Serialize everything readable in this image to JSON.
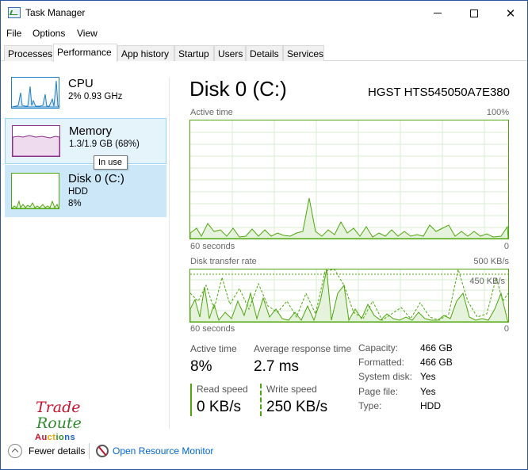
{
  "window": {
    "title": "Task Manager"
  },
  "menu": {
    "file": "File",
    "options": "Options",
    "view": "View"
  },
  "tabs": [
    {
      "label": "Processes"
    },
    {
      "label": "Performance",
      "active": true
    },
    {
      "label": "App history"
    },
    {
      "label": "Startup"
    },
    {
      "label": "Users"
    },
    {
      "label": "Details"
    },
    {
      "label": "Services"
    }
  ],
  "sidebar": {
    "cpu": {
      "name": "CPU",
      "detail": "2%  0.93 GHz",
      "color": "#1c7ec4"
    },
    "memory": {
      "name": "Memory",
      "detail": "1.3/1.9 GB (68%)",
      "color": "#8b2d8b"
    },
    "disk": {
      "name": "Disk 0 (C:)",
      "type": "HDD",
      "usage": "8%",
      "color": "#4da60c"
    },
    "tooltip": "In use"
  },
  "detail": {
    "title": "Disk 0 (C:)",
    "model": "HGST HTS545050A7E380",
    "active_graph": {
      "label": "Active time",
      "max_label": "100%",
      "time_label": "60 seconds",
      "min_label": "0"
    },
    "transfer_graph": {
      "label": "Disk transfer rate",
      "max_label": "500 KB/s",
      "ref_label": "450 KB/s",
      "time_label": "60 seconds",
      "min_label": "0"
    },
    "stats": {
      "active_time_label": "Active time",
      "active_time_value": "8%",
      "avg_response_label": "Average response time",
      "avg_response_value": "2.7 ms",
      "read_speed_label": "Read speed",
      "read_speed_value": "0 KB/s",
      "write_speed_label": "Write speed",
      "write_speed_value": "250 KB/s"
    },
    "properties": [
      {
        "key": "Capacity:",
        "value": "466 GB"
      },
      {
        "key": "Formatted:",
        "value": "466 GB"
      },
      {
        "key": "System disk:",
        "value": "Yes"
      },
      {
        "key": "Page file:",
        "value": "Yes"
      },
      {
        "key": "Type:",
        "value": "HDD"
      }
    ]
  },
  "logo": {
    "line1": "Trade",
    "line2": "Route",
    "line3": "Auctions"
  },
  "footer": {
    "fewer_details": "Fewer details",
    "resource_monitor": "Open Resource Monitor"
  }
}
